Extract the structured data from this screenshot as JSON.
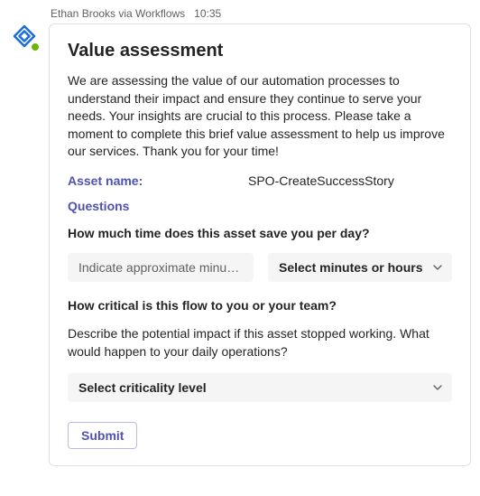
{
  "header": {
    "sender": "Ethan Brooks via Workflows",
    "time": "10:35"
  },
  "card": {
    "title": "Value assessment",
    "description": "We are assessing the value of our automation processes to understand their impact and ensure they continue to serve your needs. Your insights are crucial to this process. Please take a moment to complete this brief value assessment to help us improve our services. Thank you for your time!",
    "asset_label": "Asset name:",
    "asset_value": "SPO-CreateSuccessStory",
    "questions_label": "Questions",
    "q1": {
      "text": "How much time does this asset save you per day?",
      "input_placeholder": "Indicate approximate minutes",
      "select_placeholder": "Select minutes or hours"
    },
    "q2": {
      "text": "How critical is this flow to you or your team?",
      "desc": "Describe the potential impact if this asset stopped working. What would happen to your daily operations?",
      "select_placeholder": "Select criticality level"
    },
    "submit_label": "Submit"
  }
}
